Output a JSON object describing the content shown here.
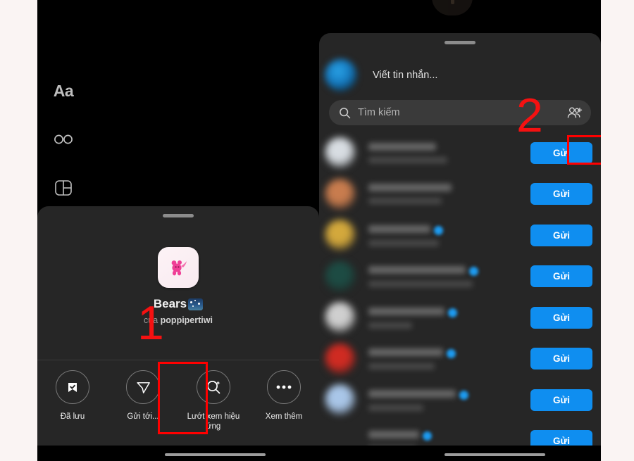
{
  "app": {
    "platform": "instagram-reels-share",
    "background_color": "#faf4f3",
    "screen_background": "#000000",
    "sheet_background": "#262626",
    "accent_blue": "#0f8ef0",
    "annotation_red": "#ff0000"
  },
  "editor_tools": [
    {
      "name": "text-tool",
      "glyph": "Aa",
      "label": "Aa"
    },
    {
      "name": "loop-tool",
      "glyph": "infinity",
      "label": "∞"
    },
    {
      "name": "layout-tool",
      "glyph": "layout",
      "label": ""
    },
    {
      "name": "effects-tool",
      "glyph": "sparkle-circle",
      "label": ""
    }
  ],
  "left_sheet": {
    "handle": true,
    "sticker": {
      "title": "Bears",
      "title_emoji": "night-with-stars",
      "by_prefix": "của",
      "author": "poppipertiwi"
    },
    "actions": [
      {
        "icon": "saved-bookmark-check-icon",
        "label": "Đã lưu",
        "highlighted": false
      },
      {
        "icon": "paper-plane-icon",
        "label": "Gửi tới...",
        "highlighted": true
      },
      {
        "icon": "magic-search-icon",
        "label": "Lướt xem hiệu ứng",
        "highlighted": false
      },
      {
        "icon": "ellipsis-icon",
        "label": "Xem thêm",
        "highlighted": false
      }
    ]
  },
  "right_sheet": {
    "handle": true,
    "message_row": {
      "placeholder": "Viết tin nhắn...",
      "avatar_color": "#1578bd"
    },
    "search": {
      "placeholder": "Tìm kiếm",
      "icon": "search-icon",
      "trailing_icon": "add-people-icon"
    },
    "send_button_label": "Gửi",
    "contacts": [
      {
        "avatar_color": "#d8dde2",
        "verified": false,
        "name_width": 96,
        "sub_width": 112,
        "highlighted": true
      },
      {
        "avatar_color": "#c87c4e",
        "verified": false,
        "name_width": 118,
        "sub_width": 104,
        "highlighted": false
      },
      {
        "avatar_color": "#d3a83c",
        "verified": true,
        "name_width": 88,
        "sub_width": 100,
        "highlighted": false
      },
      {
        "avatar_color": "#1d4b43",
        "verified": true,
        "name_width": 138,
        "sub_width": 148,
        "highlighted": false
      },
      {
        "avatar_color": "#cfcfcf",
        "verified": true,
        "name_width": 108,
        "sub_width": 62,
        "highlighted": false
      },
      {
        "avatar_color": "#cf2b22",
        "verified": true,
        "name_width": 106,
        "sub_width": 94,
        "highlighted": false
      },
      {
        "avatar_color": "#a9c6e8",
        "verified": true,
        "name_width": 124,
        "sub_width": 78,
        "highlighted": false
      },
      {
        "avatar_color": "#d9a martyr",
        "verified": true,
        "name_width": 72,
        "sub_width": 68,
        "highlighted": false
      }
    ]
  },
  "annotations": [
    {
      "label": "1",
      "target": "gui-toi-action"
    },
    {
      "label": "2",
      "target": "first-send-button"
    }
  ]
}
